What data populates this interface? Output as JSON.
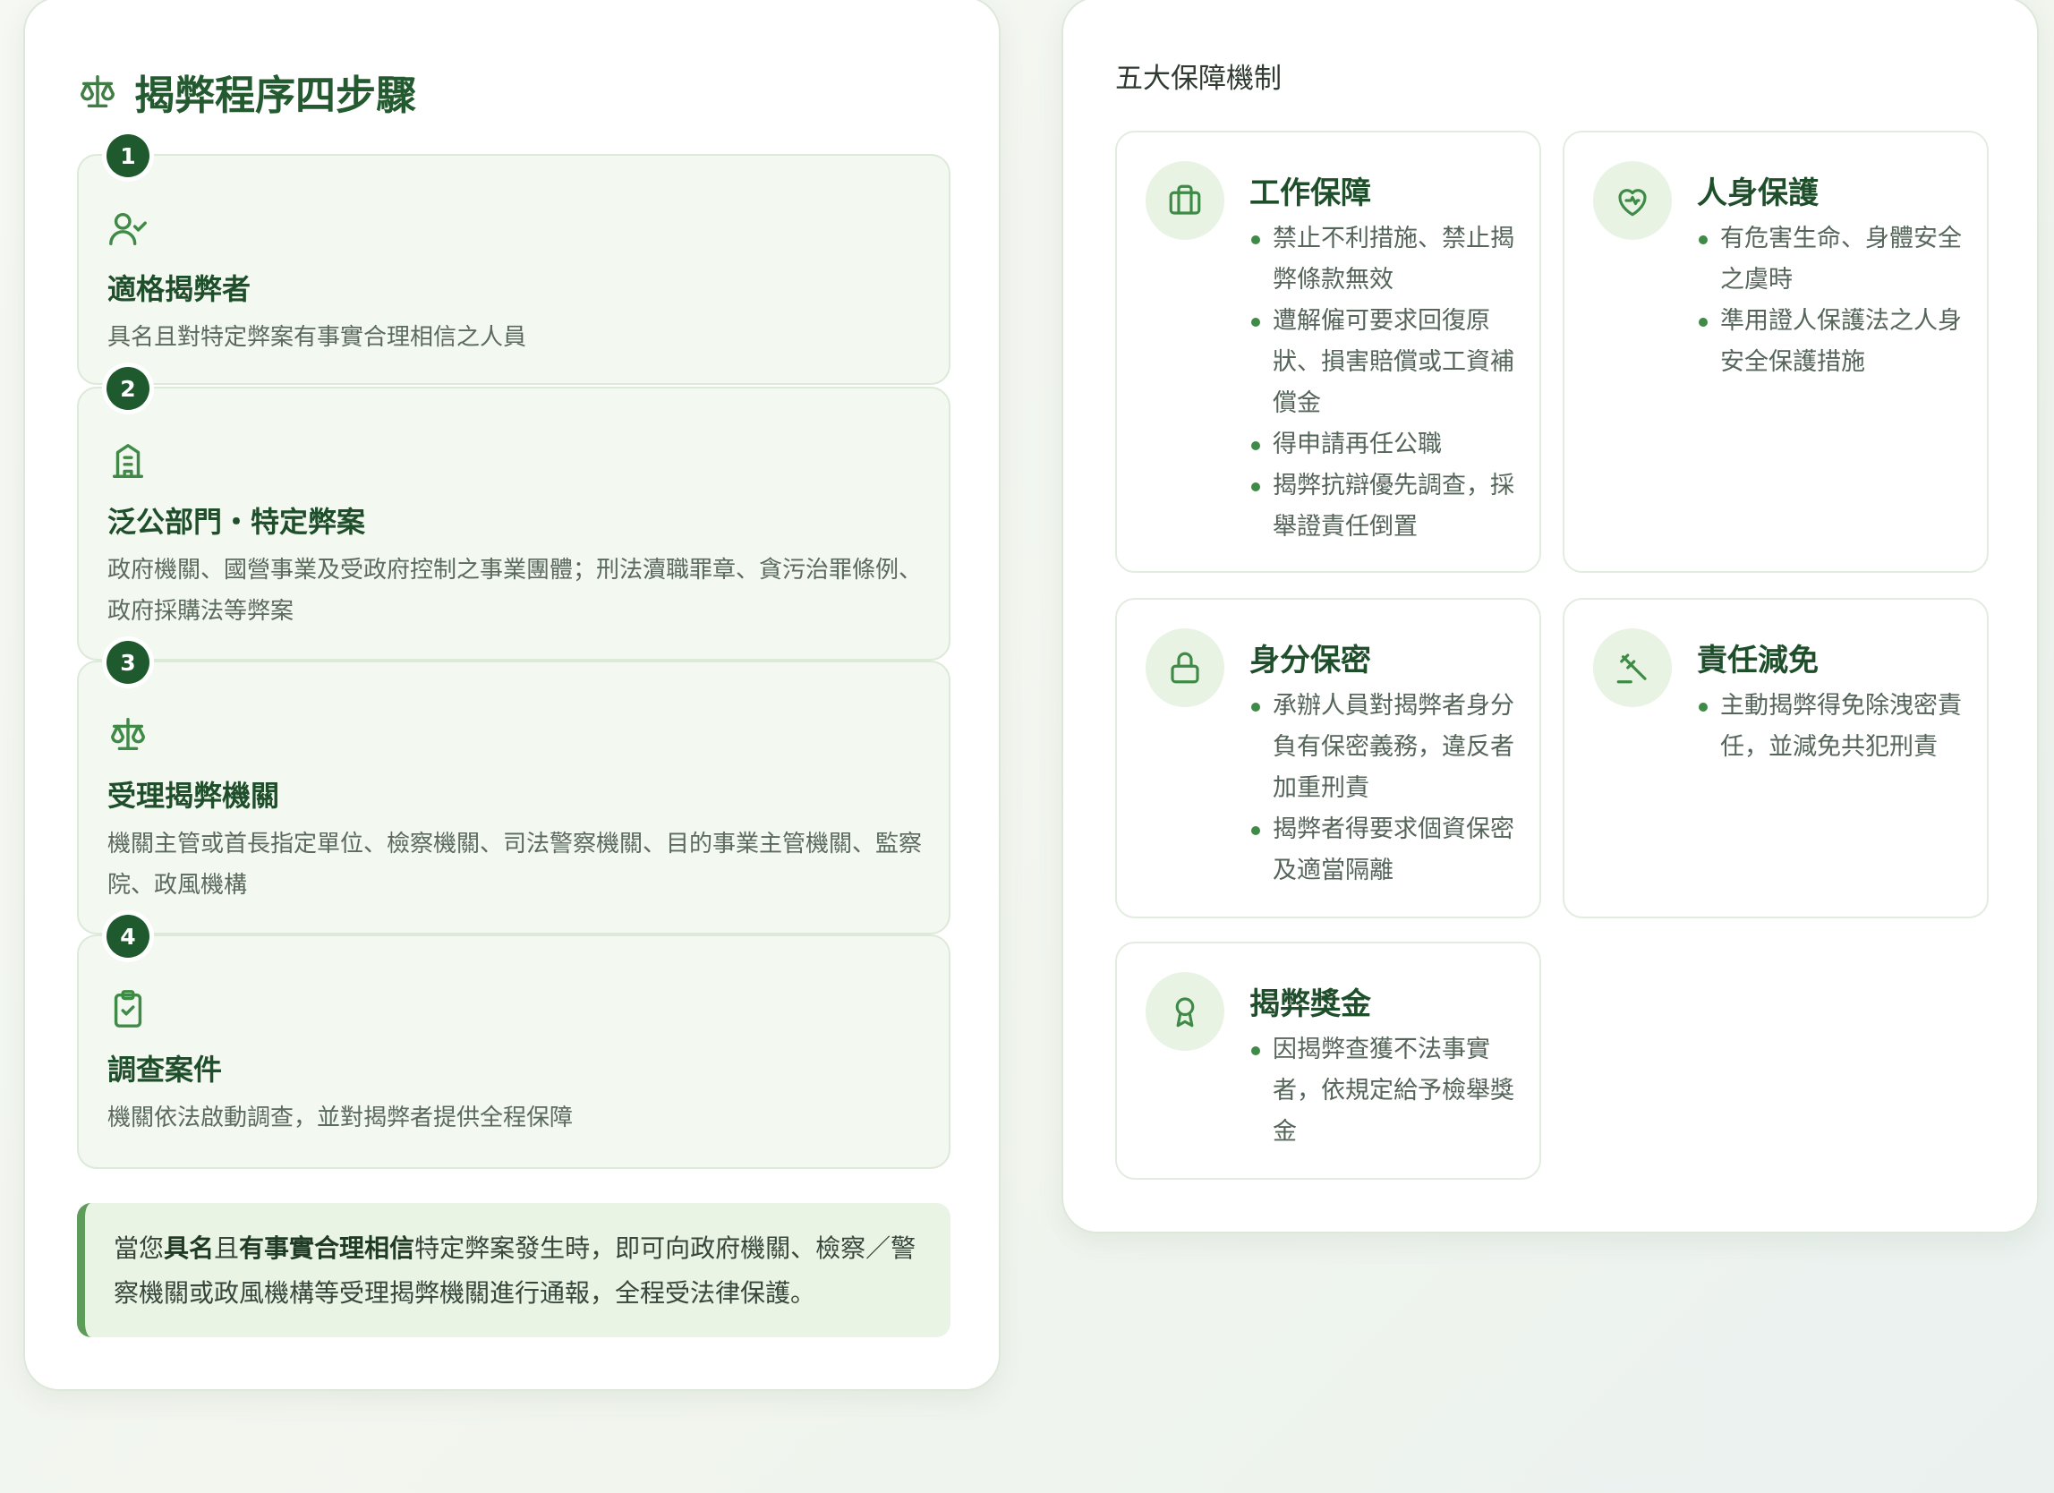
{
  "steps_section": {
    "title": "揭弊程序四步驟",
    "steps": [
      {
        "number": "1",
        "icon": "user-check-icon",
        "title": "適格揭弊者",
        "desc": "具名且對特定弊案有事實合理相信之人員"
      },
      {
        "number": "2",
        "icon": "building-icon",
        "title": "泛公部門・特定弊案",
        "desc": "政府機關、國營事業及受政府控制之事業團體；刑法瀆職罪章、貪污治罪條例、政府採購法等弊案"
      },
      {
        "number": "3",
        "icon": "scale-icon",
        "title": "受理揭弊機關",
        "desc": "機關主管或首長指定單位、檢察機關、司法警察機關、目的事業主管機關、監察院、政風機構"
      },
      {
        "number": "4",
        "icon": "clipboard-check-icon",
        "title": "調查案件",
        "desc": "機關依法啟動調查，並對揭弊者提供全程保障"
      }
    ],
    "callout": {
      "p1": "當您",
      "b1": "具名",
      "p2": "且",
      "b2": "有事實合理相信",
      "p3": "特定弊案發生時，即可向政府機關、檢察／警察機關或政風機構等受理揭弊機關進行通報，全程受法律保護。"
    }
  },
  "protections_section": {
    "title": "五大保障機制",
    "cards": [
      {
        "icon": "briefcase-icon",
        "title": "工作保障",
        "items": [
          "禁止不利措施、禁止揭弊條款無效",
          "遭解僱可要求回復原狀、損害賠償或工資補償金",
          "得申請再任公職",
          "揭弊抗辯優先調查，採舉證責任倒置"
        ]
      },
      {
        "icon": "heart-shield-icon",
        "title": "人身保護",
        "items": [
          "有危害生命、身體安全之虞時",
          "準用證人保護法之人身安全保護措施"
        ]
      },
      {
        "icon": "lock-icon",
        "title": "身分保密",
        "items": [
          "承辦人員對揭弊者身分負有保密義務，違反者加重刑責",
          "揭弊者得要求個資保密及適當隔離"
        ]
      },
      {
        "icon": "gavel-icon",
        "title": "責任減免",
        "items": [
          "主動揭弊得免除洩密責任，並減免共犯刑責"
        ]
      },
      {
        "icon": "award-icon",
        "title": "揭弊獎金",
        "items": [
          "因揭弊查獲不法事實者，依規定給予檢舉獎金"
        ]
      }
    ]
  },
  "colors": {
    "accent": "#1f5a2e",
    "accent_light": "#e8f3e3",
    "bullet": "#3f8a47",
    "callout_border": "#5e9c5a"
  }
}
